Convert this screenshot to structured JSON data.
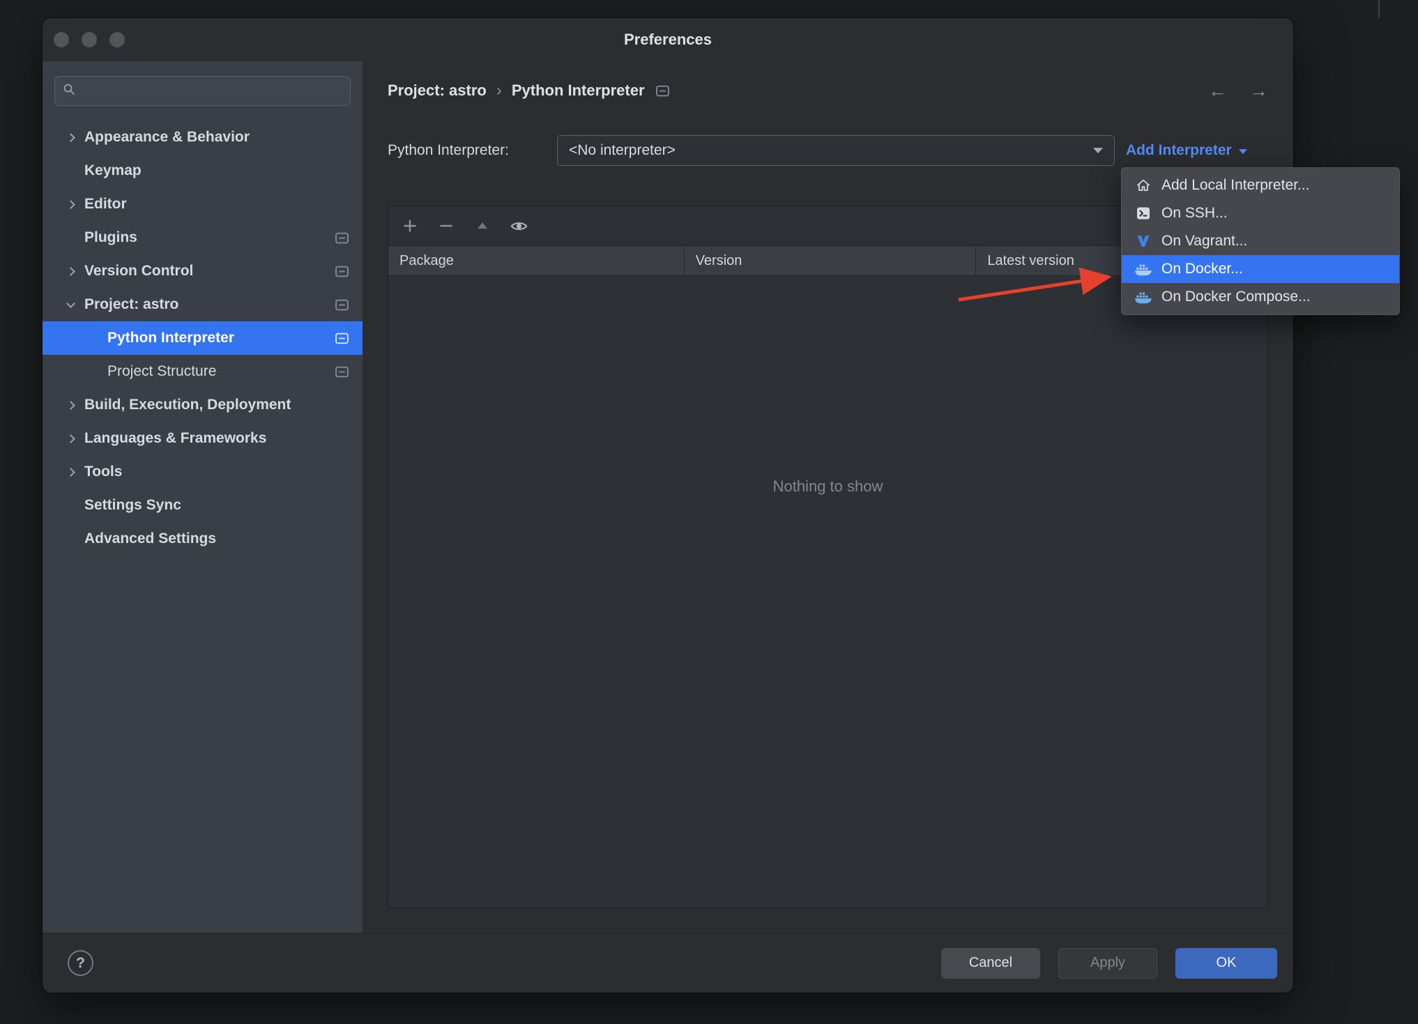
{
  "window": {
    "title": "Preferences"
  },
  "icons": {
    "back": "←",
    "forward": "→",
    "help": "?"
  },
  "colors": {
    "selection": "#3574f0",
    "link": "#548af7",
    "ok_button": "#3c69bd",
    "annotation_arrow": "#e8402f"
  },
  "sidebar": {
    "items": [
      {
        "label": "Appearance & Behavior",
        "expandable": true
      },
      {
        "label": "Keymap"
      },
      {
        "label": "Editor",
        "expandable": true
      },
      {
        "label": "Plugins"
      },
      {
        "label": "Version Control",
        "expandable": true
      },
      {
        "label": "Project: astro",
        "expandable": true,
        "expanded": true
      },
      {
        "label": "Python Interpreter",
        "child": true,
        "selected": true
      },
      {
        "label": "Project Structure",
        "child": true
      },
      {
        "label": "Build, Execution, Deployment",
        "expandable": true
      },
      {
        "label": "Languages & Frameworks",
        "expandable": true
      },
      {
        "label": "Tools",
        "expandable": true
      },
      {
        "label": "Settings Sync"
      },
      {
        "label": "Advanced Settings"
      }
    ]
  },
  "breadcrumb": {
    "project": "Project: astro",
    "separator": "›",
    "page": "Python Interpreter"
  },
  "main": {
    "interpreter_label": "Python Interpreter:",
    "interpreter_value": "<No interpreter>",
    "add_interpreter_label": "Add Interpreter"
  },
  "add_interpreter_menu": {
    "items": [
      {
        "label": "Add Local Interpreter...",
        "icon": "home-icon"
      },
      {
        "label": "On SSH...",
        "icon": "terminal-icon"
      },
      {
        "label": "On Vagrant...",
        "icon": "vagrant-icon"
      },
      {
        "label": "On Docker...",
        "icon": "docker-icon",
        "selected": true
      },
      {
        "label": "On Docker Compose...",
        "icon": "docker-compose-icon"
      }
    ]
  },
  "packages_table": {
    "columns": [
      "Package",
      "Version",
      "Latest version"
    ],
    "empty_text": "Nothing to show"
  },
  "footer": {
    "cancel": "Cancel",
    "apply": "Apply",
    "ok": "OK"
  }
}
